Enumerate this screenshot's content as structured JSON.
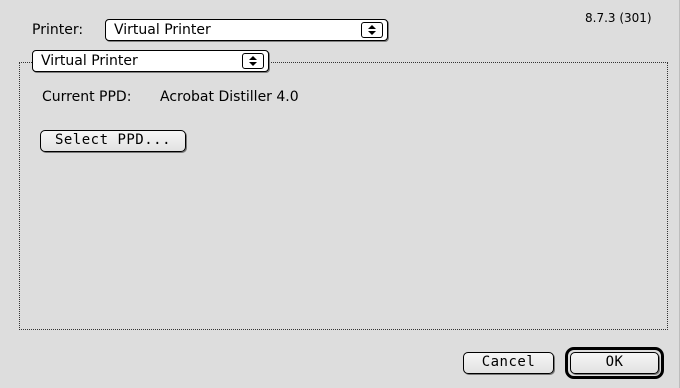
{
  "version": "8.7.3 (301)",
  "printer": {
    "label": "Printer:",
    "selected": "Virtual Printer"
  },
  "panel": {
    "selected": "Virtual Printer",
    "current_ppd_label": "Current PPD:",
    "current_ppd_value": "Acrobat Distiller 4.0",
    "select_ppd_label": "Select PPD..."
  },
  "buttons": {
    "cancel": "Cancel",
    "ok": "OK"
  }
}
